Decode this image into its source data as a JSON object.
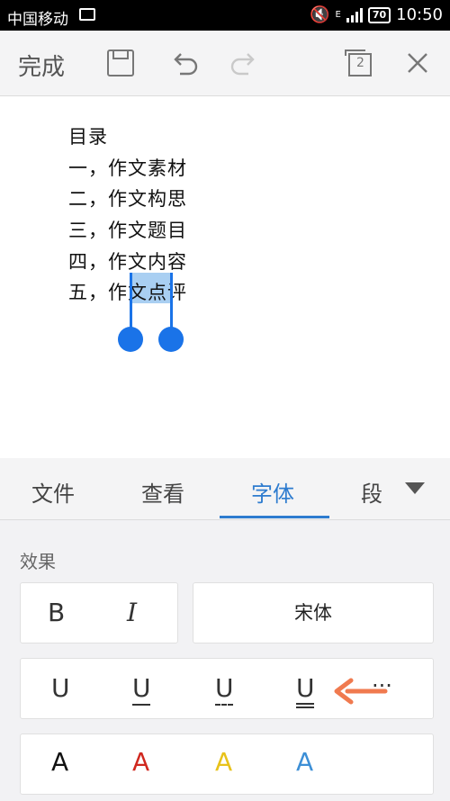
{
  "status_bar": {
    "carrier": "中国移动",
    "network": "E",
    "battery": "70",
    "time": "10:50"
  },
  "toolbar": {
    "done_label": "完成",
    "window_count": "2"
  },
  "document": {
    "lines": [
      "目录",
      "一，作文素材",
      "二，作文构思",
      "三，作文题目",
      "四，作文内容",
      "五，作文点评"
    ],
    "selected_text": "文点"
  },
  "tabs": [
    "文件",
    "查看",
    "字体",
    "段"
  ],
  "active_tab": "字体",
  "panel": {
    "section_label": "效果",
    "bold_label": "B",
    "italic_label": "I",
    "font_name": "宋体",
    "underline_labels": [
      "U",
      "U",
      "U",
      "U"
    ],
    "more_label": "···",
    "color_label": "A",
    "colors": [
      "#111111",
      "#d0281f",
      "#e8c21a",
      "#3d8fd6"
    ],
    "arrow_color": "#f07a4f"
  }
}
